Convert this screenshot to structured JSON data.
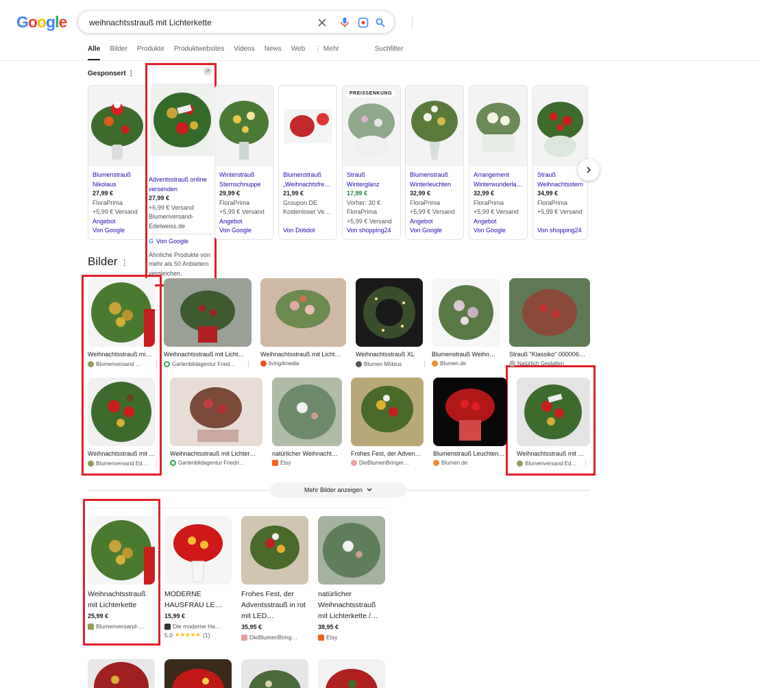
{
  "header": {
    "logo": "Google",
    "query": "weihnachtsstrauß mit Lichterkette",
    "tabs": [
      "Alle",
      "Bilder",
      "Produkte",
      "Produktwebsites",
      "Videos",
      "News",
      "Web",
      "Mehr"
    ],
    "filter": "Suchfilter"
  },
  "sponsored": {
    "label": "Gesponsert",
    "cards": [
      {
        "name": "Blumenstrauß Nikolaus",
        "price": "27,99 €",
        "seller": "FloraPrima",
        "ship": "+5,99 € Versand",
        "tag": "Angebot",
        "via": "Von Google"
      },
      {
        "name": "Adventsstrauß online versenden",
        "price": "27,99 €",
        "ship": "+6,99 € Versand",
        "seller": "Blumenversand-Edelweiss.de",
        "via": "Von Google",
        "note": "Ähnliche Produkte von mehr als 50 Anbietern vergleichen."
      },
      {
        "name": "Winterstrauß Sternschnuppe",
        "price": "29,99 €",
        "seller": "FloraPrima",
        "ship": "+5,99 € Versand",
        "tag": "Angebot",
        "via": "Von Google"
      },
      {
        "name": "Blumenstrauß „Weihnachtsfre…",
        "price": "21,99 €",
        "seller": "Groupon DE",
        "ship": "Kostenloser Ve…",
        "via": "Von Dotidot"
      },
      {
        "badge": "PREISSENKUNG",
        "name": "Strauß Winterglanz",
        "price": "17,99 €",
        "old": "Vorher: 30 €",
        "seller": "FloraPrima",
        "ship": "+5,99 € Versand",
        "via": "Von shopping24"
      },
      {
        "name": "Blumenstrauß Winterleuchten",
        "price": "32,99 €",
        "seller": "FloraPrima",
        "ship": "+5,99 € Versand",
        "tag": "Angebot",
        "via": "Von Google"
      },
      {
        "name": "Arrangement Winterwunderla…",
        "price": "32,99 €",
        "seller": "FloraPrima",
        "ship": "+5,99 € Versand",
        "tag": "Angebot",
        "via": "Von Google"
      },
      {
        "name": "Strauß Weihnachtsstern",
        "price": "34,99 €",
        "seller": "FloraPrima",
        "ship": "+5,99 € Versand",
        "via": "Von shopping24"
      }
    ]
  },
  "images": {
    "heading": "Bilder",
    "row1": [
      {
        "cap": "Weihnachtsstrauß mi…",
        "src": "Blumenversand …"
      },
      {
        "cap": "Weihnachtsstrauß mit Licht…",
        "src": "Gartenbildagentur Fried…"
      },
      {
        "cap": "Weihnachtsstrauß mit Licht…",
        "src": "living4media"
      },
      {
        "cap": "Weihnachtsstrauß XL",
        "src": "Blumen Möbius"
      },
      {
        "cap": "Blumenstrauß Weihn…",
        "src": "Blumen.de"
      },
      {
        "cap": "Strauß \"Klassiko\" 000006…",
        "src": "Natürlich Gestalten"
      }
    ],
    "row2": [
      {
        "cap": "Weihnachtsstrauß mit r…",
        "src": "Blumenversand Ed…"
      },
      {
        "cap": "Weihnachtsstrauß mit Lichter…",
        "src": "Gartenbildagentur Friedri…"
      },
      {
        "cap": "natürlicher Weihnacht…",
        "src": "Etsy"
      },
      {
        "cap": "Frohes Fest, der Adven…",
        "src": "DieBlumenBringer…"
      },
      {
        "cap": "Blumenstrauß Leuchten…",
        "src": "Blumen.de"
      },
      {
        "cap": "Weihnachtsstrauß mit …",
        "src": "Blumenversand Ed…"
      }
    ],
    "more": "Mehr Bilder anzeigen"
  },
  "shopping": [
    {
      "title": "Weihnachtsstrauß mit Lichterkette",
      "price": "25,99 €",
      "src": "Blumenversand-…"
    },
    {
      "title": "MODERNE HAUSFRAU LE…",
      "price": "15,99 €",
      "src": "Die moderne Ha…",
      "rating": "5.0",
      "stars": "★★★★★",
      "reviews": "(1)"
    },
    {
      "title": "Frohes Fest, der Adventsstrauß in rot mit LED…",
      "price": "35,95 €",
      "src": "DieBlumenBring…"
    },
    {
      "title": "natürlicher Weihnachtsstrauß mit Lichterkette /…",
      "price": "38,95 €",
      "src": "Etsy"
    }
  ],
  "colors": {
    "link": "#1a0dab",
    "highlight": "#e0202a",
    "green": "#188038"
  }
}
